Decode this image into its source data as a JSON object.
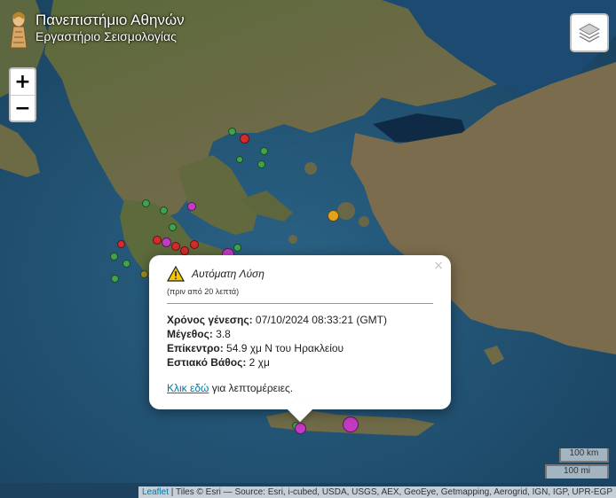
{
  "brand": {
    "title": "Πανεπιστήμιο Αθηνών",
    "subtitle": "Εργαστήριο Σεισμολογίας"
  },
  "zoom": {
    "in_label": "+",
    "out_label": "−"
  },
  "layers_icon": "layers-icon",
  "popup": {
    "icon": "warning-icon",
    "title": "Αυτόματη Λύση",
    "ago": "(πριν από 20 λεπτά)",
    "origin_label": "Χρόνος γένεσης:",
    "origin_value": " 07/10/2024 08:33:21 (GMT)",
    "magnitude_label": "Μέγεθος:",
    "magnitude_value": " 3.8",
    "epicenter_label": "Επίκεντρο:",
    "epicenter_value": " 54.9 χμ Ν του Ηρακλείου",
    "depth_label": "Εστιακό Βάθος:",
    "depth_value": " 2 χμ",
    "link_label": "Κλικ εδώ",
    "link_suffix": " για λεπτομέρειες.",
    "close_label": "×"
  },
  "scale": {
    "km": "100 km",
    "mi": "100 mi"
  },
  "attribution": {
    "leaflet": "Leaflet",
    "tiles": " | Tiles © Esri — Source: Esri, i-cubed, USDA, USGS, AEX, GeoEye, Getmapping, Aerogrid, IGN, IGP, UPR-EGP"
  },
  "colors": {
    "green": "#3fa34d",
    "red": "#d42b2b",
    "magenta": "#c23bc2",
    "yellow": "#e3a21a",
    "olive": "#9a8a2a"
  }
}
